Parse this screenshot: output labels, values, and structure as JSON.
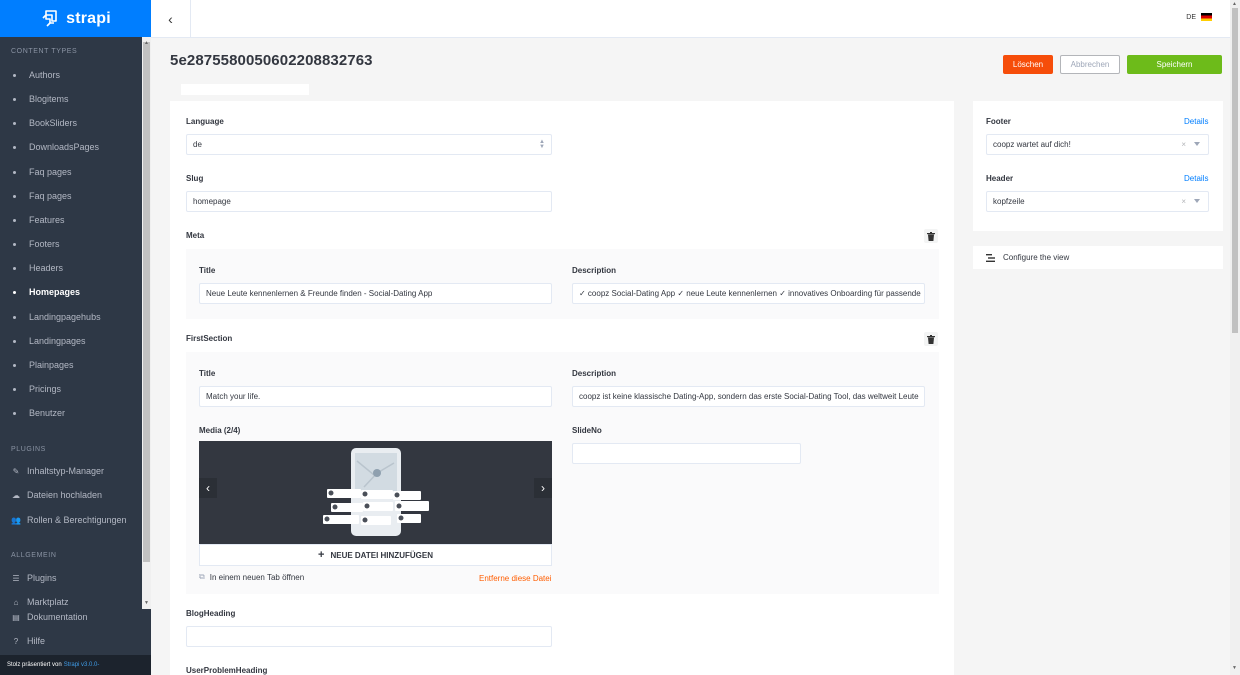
{
  "brand": {
    "name": "strapi"
  },
  "sidebar": {
    "content_types_heading": "Content Types",
    "content_types": [
      {
        "label": "Authors",
        "active": false
      },
      {
        "label": "Blogitems",
        "active": false
      },
      {
        "label": "BookSliders",
        "active": false
      },
      {
        "label": "DownloadsPages",
        "active": false
      },
      {
        "label": "Faq pages",
        "active": false
      },
      {
        "label": "Faq pages",
        "active": false
      },
      {
        "label": "Features",
        "active": false
      },
      {
        "label": "Footers",
        "active": false
      },
      {
        "label": "Headers",
        "active": false
      },
      {
        "label": "Homepages",
        "active": true
      },
      {
        "label": "Landingpagehubs",
        "active": false
      },
      {
        "label": "Landingpages",
        "active": false
      },
      {
        "label": "Plainpages",
        "active": false
      },
      {
        "label": "Pricings",
        "active": false
      },
      {
        "label": "Benutzer",
        "active": false
      }
    ],
    "plugins_heading": "Plugins",
    "plugins": [
      {
        "label": "Inhaltstyp-Manager",
        "icon": "paintbrush-icon"
      },
      {
        "label": "Dateien hochladen",
        "icon": "cloud-upload-icon"
      },
      {
        "label": "Rollen & Berechtigungen",
        "icon": "users-icon"
      }
    ],
    "general_heading": "Allgemein",
    "general": [
      {
        "label": "Plugins",
        "icon": "list-icon"
      },
      {
        "label": "Marktplatz",
        "icon": "shopping-basket-icon"
      },
      {
        "label": "Dokumentation",
        "icon": "book-icon"
      },
      {
        "label": "Hilfe",
        "icon": "question-circle-icon"
      }
    ],
    "footer_text": "Stolz präsentiert von",
    "footer_link": "Strapi v3.0.0-"
  },
  "topbar": {
    "lang_code": "DE",
    "lang_flag": "german-flag"
  },
  "page": {
    "title": "5e287558005060220883276​3"
  },
  "actions": {
    "delete": "Löschen",
    "cancel": "Abbrechen",
    "save": "Speichern"
  },
  "form": {
    "language_label": "Language",
    "language_value": "de",
    "slug_label": "Slug",
    "slug_value": "homepage",
    "meta_label": "Meta",
    "meta_title_label": "Title",
    "meta_title_value": "Neue Leute kennenlernen & Freunde finden - Social-Dating App",
    "meta_desc_label": "Description",
    "meta_desc_value": "✓ coopz Social-Dating App ✓ neue Leute kennenlernen ✓ innovatives Onboarding für passende",
    "first_section_label": "FirstSection",
    "fs_title_label": "Title",
    "fs_title_value": "Match your life.",
    "fs_desc_label": "Description",
    "fs_desc_value": "coopz ist keine klassische Dating-App, sondern das erste Social-Dating Tool, das weltweit Leute",
    "media_label": "Media (2/4)",
    "slide_no_label": "SlideNo",
    "slide_no_value": "",
    "media_add_label": "NEUE DATEI HINZUFÜGEN",
    "media_open_label": "In einem neuen Tab öffnen",
    "media_remove_label": "Entferne diese Datei",
    "blog_heading_label": "BlogHeading",
    "blog_heading_value": "",
    "user_problem_heading_label": "UserProblemHeading"
  },
  "relations": {
    "footer_label": "Footer",
    "footer_details": "Details",
    "footer_value": "coopz wartet auf dich!",
    "header_label": "Header",
    "header_details": "Details",
    "header_value": "kopfzeile",
    "configure_label": "Configure the view"
  },
  "colors": {
    "brand_blue": "#007eff",
    "sidebar_bg": "#2e3846",
    "delete_orange": "#f64d0a",
    "save_green": "#6dbb1a"
  }
}
